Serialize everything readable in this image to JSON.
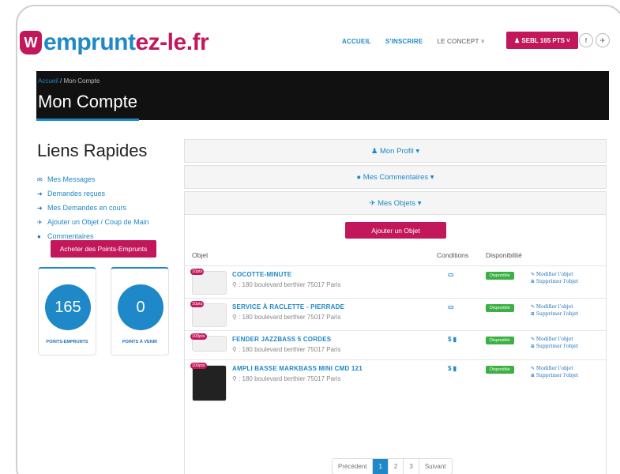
{
  "brand": {
    "logo_hand": "W",
    "name_part1": "emprunt",
    "name_part2": "ez-le.fr"
  },
  "nav": {
    "accueil": "ACCUEIL",
    "sinscrire": "S'INSCRIRE",
    "concept": "LE CONCEPT ˅",
    "user": "♟ SEBL 165 PTS ˅",
    "facebook": "f",
    "twitter": "✈"
  },
  "banner": {
    "crumb_home": "Accueil",
    "crumb_sep": " / ",
    "crumb_current": "Mon Compte",
    "title": "Mon Compte"
  },
  "sidebar": {
    "title": "Liens Rapides",
    "links": [
      {
        "icon": "✉",
        "label": "Mes Messages"
      },
      {
        "icon": "➜",
        "label": "Demandes reçues"
      },
      {
        "icon": "➜",
        "label": "Mes Demandes en cours"
      },
      {
        "icon": "✈",
        "label": "Ajouter un Objet / Coup de Main"
      },
      {
        "icon": "●",
        "label": "Commentaires"
      }
    ],
    "buy_label": "Acheter des Points-Emprunts",
    "stats": [
      {
        "value": "165",
        "label": "POINTS-EMPRUNTS"
      },
      {
        "value": "0",
        "label": "POINTS À VENIR"
      }
    ]
  },
  "accordion": {
    "profile": "♟ Mon Profil ▾",
    "comments": "● Mes Commentaires ▾",
    "objects": "✈ Mes Objets ▾",
    "add_label": "Ajouter un Objet",
    "columns": {
      "objet": "Objet",
      "conditions": "Conditions",
      "disponibilite": "Disponibilité"
    },
    "items": [
      {
        "badge": "10pts",
        "title": "COCOTTE-MINUTE",
        "address": "⚲ : 180 boulevard berthier 75017 Paris",
        "conditions": "▭",
        "availability": "Disponible",
        "edit": "✎ Modifier l'objet",
        "delete": "⊞ Supprimer l'objet"
      },
      {
        "badge": "10pts",
        "title": "SERVICE À RACLETTE - PIERRADE",
        "address": "⚲ : 180 boulevard berthier 75017 Paris",
        "conditions": "▭",
        "availability": "Disponible",
        "edit": "✎ Modifier l'objet",
        "delete": "⊞ Supprimer l'objet"
      },
      {
        "badge": "100pts",
        "title": "FENDER JAZZBASS 5 CORDES",
        "address": "⚲ : 180 boulevard berthier 75017 Paris",
        "conditions": "$ ▮",
        "availability": "Disponible",
        "edit": "✎ Modifier l'objet",
        "delete": "⊞ Supprimer l'objet"
      },
      {
        "badge": "100pts",
        "title": "AMPLI BASSE MARKBASS MINI CMD 121",
        "address": "⚲ : 180 boulevard berthier 75017 Paris",
        "conditions": "$ ▮",
        "availability": "Disponible",
        "edit": "✎ Modifier l'objet",
        "delete": "⊞ Supprimer l'objet"
      }
    ],
    "pager": {
      "prev": "Précédent",
      "p1": "1",
      "p2": "2",
      "p3": "3",
      "next": "Suivant"
    }
  },
  "colors": {
    "accent_blue": "#1e88c8",
    "brand_pink": "#c2185b",
    "available_green": "#3cb043"
  }
}
